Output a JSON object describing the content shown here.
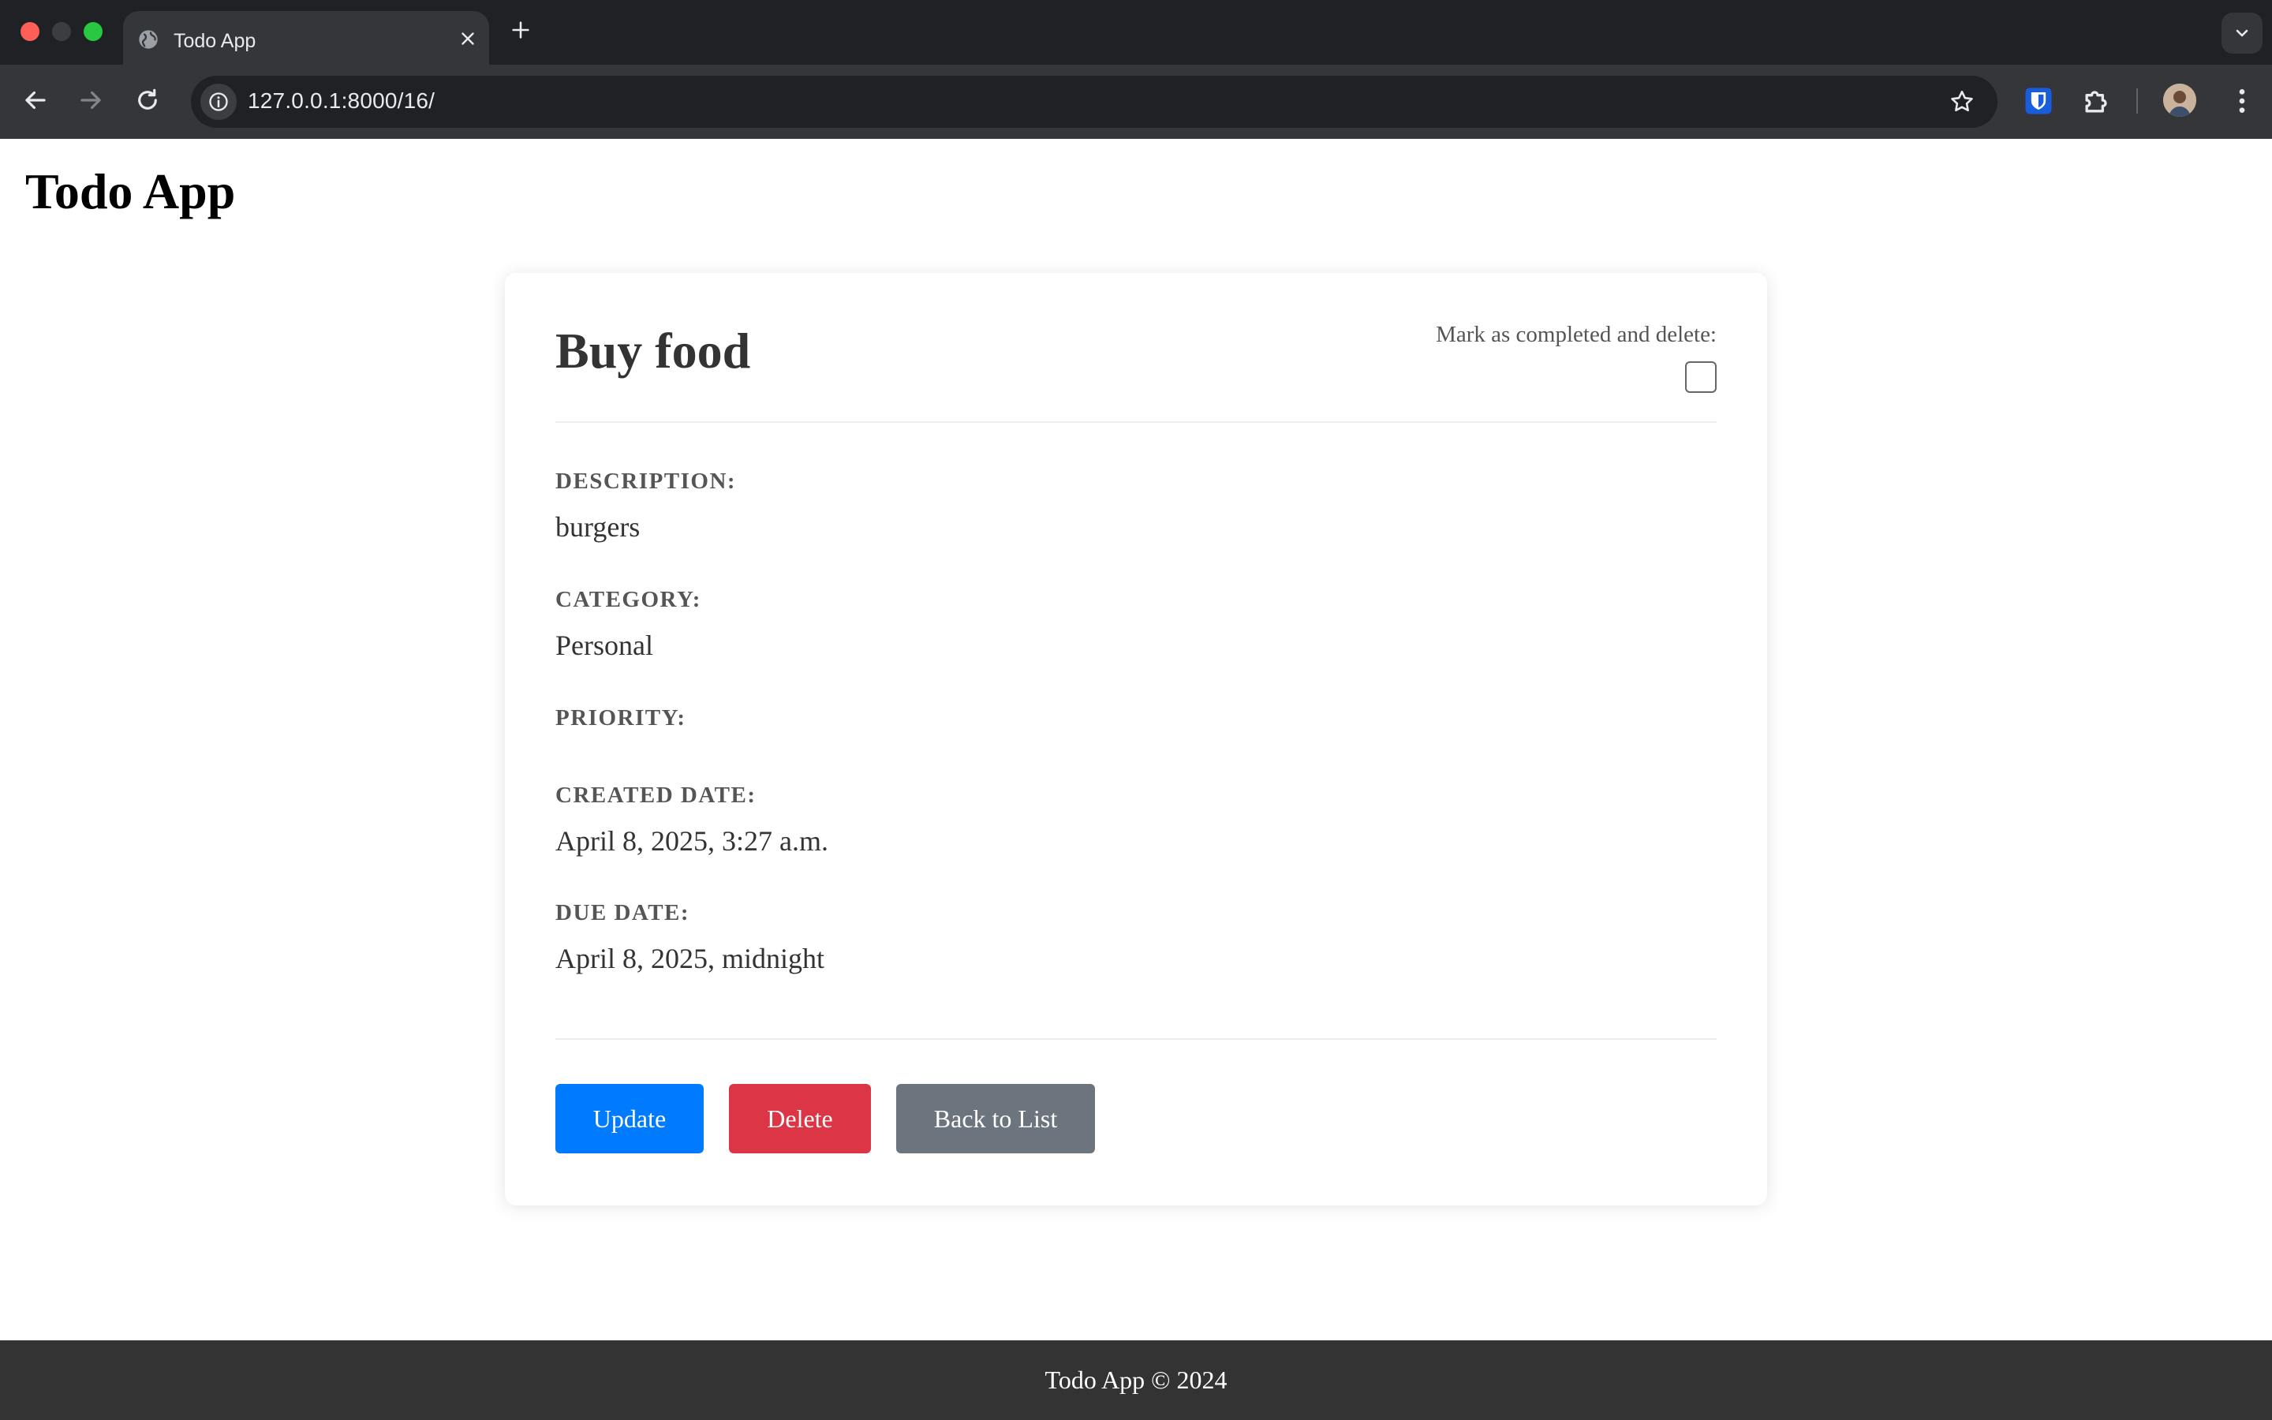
{
  "browser": {
    "tab_title": "Todo App",
    "url": "127.0.0.1:8000/16/",
    "icons": {
      "tab": "globe-icon",
      "close": "close-icon",
      "new_tab": "plus-icon",
      "back": "arrow-left-icon",
      "forward": "arrow-right-icon",
      "reload": "reload-icon",
      "info": "info-icon",
      "bookmark": "star-icon",
      "bitwarden": "shield-icon",
      "extensions": "puzzle-icon",
      "menu": "kebab-menu-icon"
    }
  },
  "page": {
    "app_title": "Todo App",
    "todo": {
      "title": "Buy food",
      "complete_label": "Mark as completed and delete:",
      "completed": false,
      "fields": [
        {
          "label": "Description:",
          "value": "burgers"
        },
        {
          "label": "Category:",
          "value": "Personal"
        },
        {
          "label": "Priority:",
          "value": ""
        },
        {
          "label": "Created Date:",
          "value": "April 8, 2025, 3:27 a.m."
        },
        {
          "label": "Due Date:",
          "value": "April 8, 2025, midnight"
        }
      ]
    },
    "buttons": {
      "update": "Update",
      "delete": "Delete",
      "back": "Back to List"
    },
    "footer": "Todo App © 2024"
  },
  "colors": {
    "update": "#007bff",
    "delete": "#dc3545",
    "back": "#6c757d",
    "footer_bg": "#333333"
  }
}
